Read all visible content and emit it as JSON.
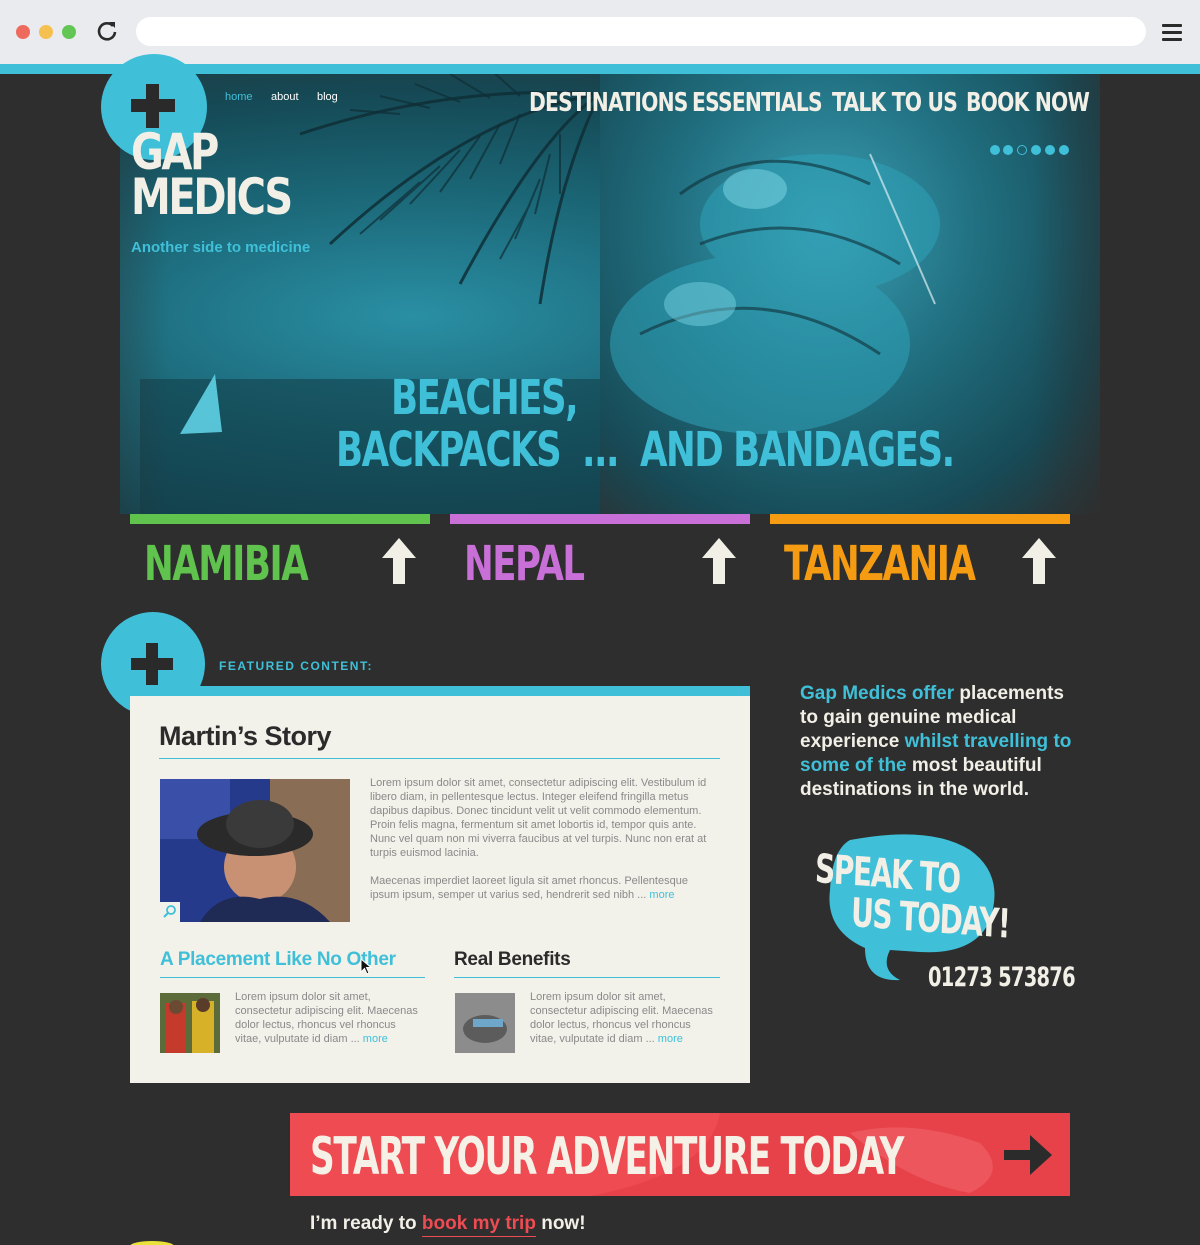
{
  "browser": {
    "url": "",
    "icons": [
      "close-dot",
      "minimize-dot",
      "maximize-dot",
      "reload-icon",
      "menu-icon"
    ]
  },
  "logo": {
    "line1": "GAP",
    "line2": "MEDICS",
    "tagline": "Another side to medicine"
  },
  "subnav": {
    "home": "home",
    "about": "about",
    "blog": "blog"
  },
  "mainnav": {
    "destinations": "DESTINATIONS",
    "essentials": "ESSENTIALS",
    "talk": "TALK TO US",
    "book": "BOOK NOW"
  },
  "carousel": {
    "slides": 6,
    "active_index": 2
  },
  "hero": {
    "line1": "BEACHES,",
    "line2_a": "BACKPACKS",
    "line2_b": "...",
    "line2_c": "AND BANDAGES."
  },
  "destinations": [
    {
      "name": "NAMIBIA",
      "color": "#5fc34d"
    },
    {
      "name": "NEPAL",
      "color": "#c96fd8"
    },
    {
      "name": "TANZANIA",
      "color": "#f59c13"
    }
  ],
  "featured": {
    "label": "FEATURED CONTENT:",
    "story_title": "Martin’s Story",
    "story_p1": "Lorem ipsum dolor sit amet, consectetur adipiscing elit. Vestibulum id libero diam, in pellentesque lectus. Integer eleifend fringilla metus dapibus dapibus. Donec tincidunt velit ut velit commodo elementum. Proin felis magna, fermentum sit amet lobortis id, tempor quis ante. Nunc vel quam non mi viverra faucibus at vel turpis. Nunc non erat at turpis euismod lacinia.",
    "story_p2": "Maecenas imperdiet laoreet ligula sit amet rhoncus. Pellentesque ipsum ipsum, semper ut varius sed, hendrerit sed nibh ...",
    "more": "more",
    "sub1_title": "A Placement Like No Other",
    "sub1_text": "Lorem ipsum dolor sit amet, consectetur adipiscing elit. Maecenas dolor lectus, rhoncus vel rhoncus vitae, vulputate id diam ...",
    "sub2_title": "Real Benefits",
    "sub2_text": "Lorem ipsum dolor sit amet, consectetur adipiscing elit. Maecenas dolor lectus, rhoncus vel rhoncus vitae, vulputate id diam ..."
  },
  "intro": {
    "p1": "Gap Medics offer",
    "p2": " placements to gain genuine medical experience ",
    "p3": "whilst travelling to some of the",
    "p4": " most beautiful destinations in the world."
  },
  "speak": {
    "line1": "SPEAK TO",
    "line2": "US TODAY!",
    "phone": "01273 573876"
  },
  "cta": {
    "banner": "START YOUR ADVENTURE TODAY",
    "ready_pre": "I’m ready to ",
    "ready_link": "book my trip",
    "ready_post": " now!"
  },
  "colors": {
    "accent": "#3fc0d8",
    "background": "#2e2e2e",
    "panel": "#f2f1ea",
    "cta": "#ee4b52",
    "cream": "#f1efe6"
  }
}
